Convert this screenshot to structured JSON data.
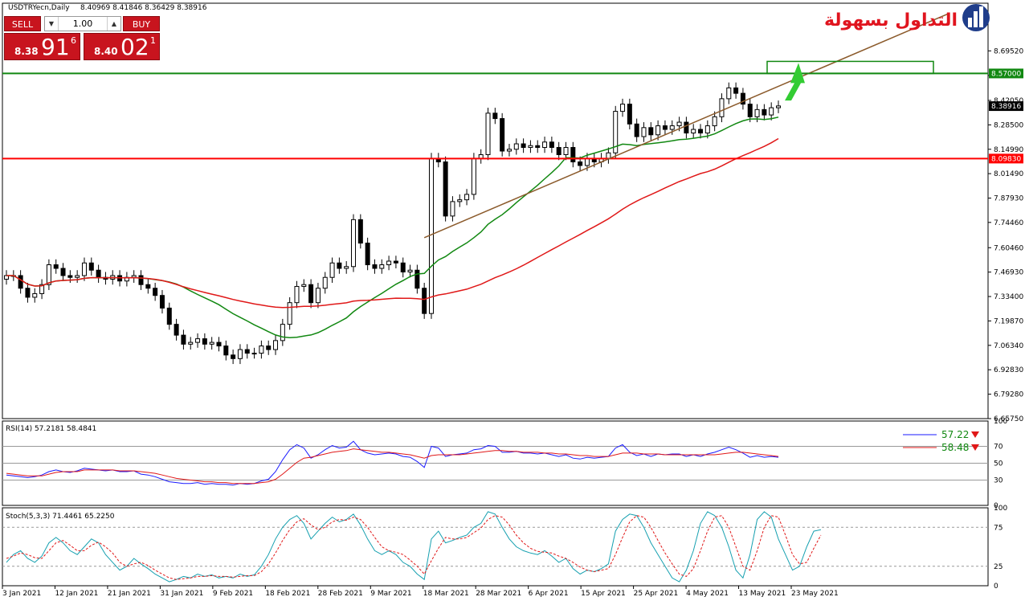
{
  "header": {
    "symbol": "USDTRYecn,Daily",
    "ohlc": "8.40969 8.41846 8.36429 8.38916"
  },
  "trade_panel": {
    "sell_label": "SELL",
    "buy_label": "BUY",
    "lot": "1.00",
    "sell_small": "8.38",
    "sell_big": "91",
    "sell_pip": "6",
    "buy_small": "8.40",
    "buy_big": "02",
    "buy_pip": "1"
  },
  "logo": {
    "text": "التداول بسهولة"
  },
  "colors": {
    "candle": "#000000",
    "ma_fast": "#118811",
    "ma_slow": "#e01818",
    "trend": "#8b5a2b",
    "level": "#ff0000",
    "resistance": "#118811",
    "rsi": "#1a1aff",
    "rsi_signal": "#e01818",
    "stoch": "#16a0b0",
    "stoch_signal": "#e01818"
  },
  "chart_data": [
    {
      "type": "candlestick",
      "title": "USDTRYecn,Daily",
      "ylim": [
        6.6575,
        8.9592
      ],
      "y_ticks": [
        "8.69520",
        "8.55900",
        "8.42050",
        "8.28500",
        "8.14990",
        "8.01490",
        "7.87930",
        "7.74460",
        "7.60460",
        "7.46930",
        "7.33400",
        "7.19870",
        "7.06340",
        "6.92830",
        "6.79280",
        "6.65750"
      ],
      "x_ticks": [
        "3 Jan 2021",
        "12 Jan 2021",
        "21 Jan 2021",
        "31 Jan 2021",
        "9 Feb 2021",
        "18 Feb 2021",
        "28 Feb 2021",
        "9 Mar 2021",
        "18 Mar 2021",
        "28 Mar 2021",
        "6 Apr 2021",
        "15 Apr 2021",
        "25 Apr 2021",
        "4 May 2021",
        "13 May 2021",
        "23 May 2021"
      ],
      "price_tags": {
        "resistance": "8.57000",
        "current": "8.38916",
        "support": "8.09830"
      },
      "levels": {
        "resistance": 8.57,
        "support": 8.0983
      },
      "close": [
        7.45,
        7.45,
        7.38,
        7.33,
        7.35,
        7.4,
        7.51,
        7.49,
        7.45,
        7.44,
        7.45,
        7.52,
        7.48,
        7.44,
        7.43,
        7.45,
        7.42,
        7.44,
        7.45,
        7.4,
        7.38,
        7.34,
        7.27,
        7.18,
        7.12,
        7.07,
        7.08,
        7.1,
        7.07,
        7.08,
        7.06,
        7.01,
        6.99,
        7.04,
        7.02,
        7.02,
        7.06,
        7.04,
        7.09,
        7.18,
        7.3,
        7.39,
        7.4,
        7.3,
        7.38,
        7.44,
        7.52,
        7.49,
        7.5,
        7.76,
        7.63,
        7.51,
        7.49,
        7.51,
        7.53,
        7.52,
        7.47,
        7.48,
        7.38,
        7.24,
        8.1,
        8.08,
        7.78,
        7.86,
        7.87,
        7.9,
        8.1,
        8.12,
        8.35,
        8.32,
        8.14,
        8.15,
        8.18,
        8.16,
        8.17,
        8.16,
        8.19,
        8.16,
        8.12,
        8.16,
        8.08,
        8.06,
        8.1,
        8.08,
        8.1,
        8.13,
        8.36,
        8.4,
        8.29,
        8.22,
        8.27,
        8.23,
        8.28,
        8.26,
        8.28,
        8.3,
        8.24,
        8.26,
        8.24,
        8.28,
        8.33,
        8.43,
        8.49,
        8.46,
        8.4,
        8.33,
        8.37,
        8.34,
        8.38,
        8.39
      ]
    },
    {
      "type": "line",
      "title": "RSI(14) 57.2181 58.4841",
      "ylim": [
        0,
        100
      ],
      "y_ticks": [
        "100",
        "70",
        "50",
        "30",
        "0"
      ],
      "legend": [
        {
          "name": "",
          "value": "57.22"
        },
        {
          "name": "",
          "value": "58.48"
        }
      ],
      "series": [
        {
          "name": "",
          "values": [
            36,
            35,
            34,
            33,
            34,
            36,
            40,
            42,
            40,
            39,
            41,
            44,
            43,
            42,
            41,
            42,
            40,
            40,
            41,
            37,
            36,
            34,
            31,
            28,
            27,
            26,
            26,
            27,
            25,
            26,
            25,
            25,
            24,
            26,
            25,
            26,
            29,
            31,
            40,
            54,
            66,
            72,
            68,
            56,
            60,
            66,
            71,
            68,
            69,
            76,
            66,
            62,
            60,
            61,
            62,
            61,
            58,
            57,
            52,
            45,
            70,
            68,
            58,
            60,
            61,
            62,
            66,
            67,
            71,
            70,
            63,
            63,
            64,
            62,
            62,
            61,
            62,
            60,
            58,
            60,
            56,
            55,
            57,
            56,
            57,
            58,
            68,
            72,
            63,
            59,
            61,
            58,
            61,
            60,
            61,
            61,
            58,
            60,
            58,
            61,
            63,
            66,
            69,
            66,
            62,
            57,
            59,
            57,
            58,
            57
          ]
        },
        {
          "name": "",
          "values": [
            38,
            37,
            36,
            35,
            35,
            35,
            37,
            39,
            40,
            40,
            40,
            42,
            42,
            42,
            42,
            42,
            41,
            41,
            41,
            40,
            39,
            38,
            36,
            34,
            32,
            31,
            30,
            29,
            28,
            28,
            27,
            27,
            26,
            26,
            26,
            26,
            27,
            28,
            31,
            37,
            44,
            51,
            56,
            57,
            59,
            61,
            63,
            64,
            65,
            67,
            66,
            65,
            64,
            63,
            63,
            62,
            61,
            60,
            58,
            56,
            59,
            60,
            60,
            60,
            60,
            61,
            62,
            63,
            64,
            65,
            65,
            64,
            64,
            63,
            63,
            63,
            62,
            62,
            61,
            61,
            60,
            59,
            59,
            58,
            58,
            58,
            60,
            62,
            62,
            62,
            61,
            61,
            61,
            60,
            60,
            60,
            60,
            60,
            60,
            60,
            60,
            61,
            62,
            63,
            63,
            62,
            61,
            60,
            59,
            58
          ]
        }
      ]
    },
    {
      "type": "line",
      "title": "Stoch(5,3,3) 71.4461 65.2250",
      "ylim": [
        0,
        100
      ],
      "y_ticks": [
        "100",
        "75",
        "25",
        "0"
      ],
      "series": [
        {
          "name": "",
          "values": [
            30,
            40,
            45,
            35,
            30,
            38,
            55,
            62,
            55,
            45,
            40,
            50,
            60,
            55,
            40,
            30,
            20,
            25,
            35,
            28,
            22,
            15,
            10,
            5,
            8,
            12,
            10,
            15,
            12,
            14,
            10,
            12,
            10,
            15,
            12,
            14,
            25,
            40,
            60,
            75,
            85,
            90,
            80,
            60,
            70,
            80,
            88,
            82,
            85,
            92,
            78,
            60,
            45,
            40,
            45,
            40,
            30,
            25,
            15,
            8,
            60,
            70,
            55,
            58,
            62,
            65,
            75,
            80,
            95,
            92,
            75,
            60,
            50,
            45,
            42,
            40,
            45,
            38,
            30,
            35,
            22,
            15,
            20,
            18,
            22,
            28,
            70,
            85,
            92,
            90,
            75,
            55,
            40,
            25,
            10,
            5,
            20,
            45,
            80,
            95,
            90,
            75,
            50,
            20,
            10,
            40,
            85,
            95,
            88,
            60,
            40,
            20,
            25,
            50,
            70,
            72
          ]
        },
        {
          "name": "",
          "values": [
            35,
            38,
            42,
            40,
            36,
            35,
            45,
            55,
            58,
            52,
            45,
            45,
            52,
            56,
            50,
            42,
            30,
            25,
            28,
            30,
            26,
            20,
            15,
            10,
            8,
            9,
            10,
            12,
            12,
            13,
            12,
            12,
            11,
            12,
            13,
            13,
            18,
            28,
            42,
            58,
            72,
            82,
            86,
            78,
            72,
            75,
            82,
            85,
            84,
            88,
            85,
            75,
            62,
            50,
            45,
            43,
            40,
            33,
            25,
            15,
            32,
            48,
            62,
            60,
            60,
            62,
            68,
            74,
            85,
            90,
            88,
            78,
            65,
            55,
            48,
            44,
            43,
            42,
            38,
            35,
            30,
            24,
            20,
            18,
            20,
            22,
            40,
            62,
            82,
            90,
            88,
            75,
            58,
            42,
            28,
            15,
            12,
            22,
            45,
            70,
            88,
            90,
            75,
            50,
            25,
            20,
            45,
            75,
            90,
            88,
            65,
            40,
            28,
            30,
            48,
            65
          ]
        }
      ]
    }
  ]
}
